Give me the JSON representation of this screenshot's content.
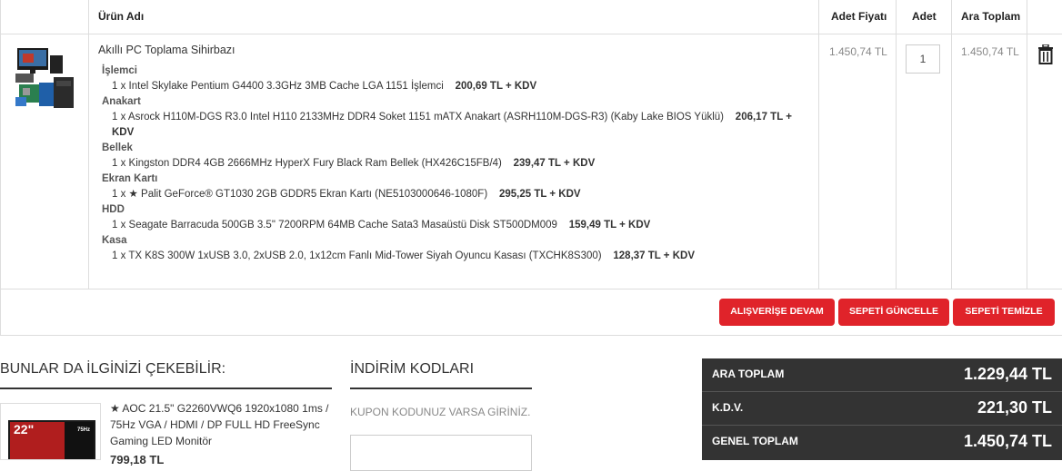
{
  "table": {
    "headers": {
      "product": "Ürün Adı",
      "unit_price": "Adet Fiyatı",
      "qty": "Adet",
      "subtotal": "Ara Toplam"
    },
    "row": {
      "name": "Akıllı PC Toplama Sihirbazı",
      "unit_price": "1.450,74 TL",
      "qty": "1",
      "subtotal": "1.450,74 TL",
      "image_icon": "pc-bundle-image",
      "delete_icon": "trash-icon",
      "parts": [
        {
          "category": "İşlemci",
          "text": "1 x Intel Skylake Pentium G4400 3.3GHz 3MB Cache LGA 1151 İşlemci",
          "price": "200,69 TL + KDV"
        },
        {
          "category": "Anakart",
          "text": "1 x Asrock H110M-DGS R3.0 Intel H110 2133MHz DDR4 Soket 1151 mATX Anakart (ASRH110M-DGS-R3) (Kaby Lake BIOS Yüklü)",
          "price": "206,17 TL + KDV"
        },
        {
          "category": "Bellek",
          "text": "1 x Kingston DDR4 4GB 2666MHz HyperX Fury Black Ram Bellek (HX426C15FB/4)",
          "price": "239,47 TL + KDV"
        },
        {
          "category": "Ekran Kartı",
          "text": "1 x ★ Palit GeForce® GT1030 2GB GDDR5 Ekran Kartı (NE5103000646-1080F)",
          "price": "295,25 TL + KDV"
        },
        {
          "category": "HDD",
          "text": "1 x Seagate Barracuda 500GB 3.5\" 7200RPM 64MB Cache Sata3 Masaüstü Disk ST500DM009",
          "price": "159,49 TL + KDV"
        },
        {
          "category": "Kasa",
          "text": "1 x TX K8S 300W 1xUSB 3.0, 2xUSB 2.0, 1x12cm Fanlı Mid-Tower Siyah Oyuncu Kasası (TXCHK8S300)",
          "price": "128,37 TL + KDV"
        }
      ]
    }
  },
  "buttons": {
    "continue": "ALIŞVERİŞE DEVAM",
    "update": "SEPETİ GÜNCELLE",
    "clear": "SEPETİ TEMİZLE"
  },
  "recommend": {
    "title": "BUNLAR DA İLGİNİZİ ÇEKEBİLİR:",
    "product": "★ AOC 21.5\" G2260VWQ6 1920x1080 1ms / 75Hz VGA / HDMI / DP FULL HD FreeSync Gaming LED Monitör",
    "thumb_badge": "22\"",
    "thumb_badge2": "75Hz",
    "price": "799,18 TL"
  },
  "coupon": {
    "title": "İNDİRİM KODLARI",
    "label": "KUPON KODUNUZ VARSA GİRİNİZ."
  },
  "totals": {
    "subtotal_label": "ARA TOPLAM",
    "subtotal": "1.229,44 TL",
    "tax_label": "K.D.V.",
    "tax": "221,30 TL",
    "grand_label": "GENEL TOPLAM",
    "grand": "1.450,74 TL"
  },
  "colors": {
    "accent": "#e0232a",
    "totals_bg": "#333333"
  }
}
